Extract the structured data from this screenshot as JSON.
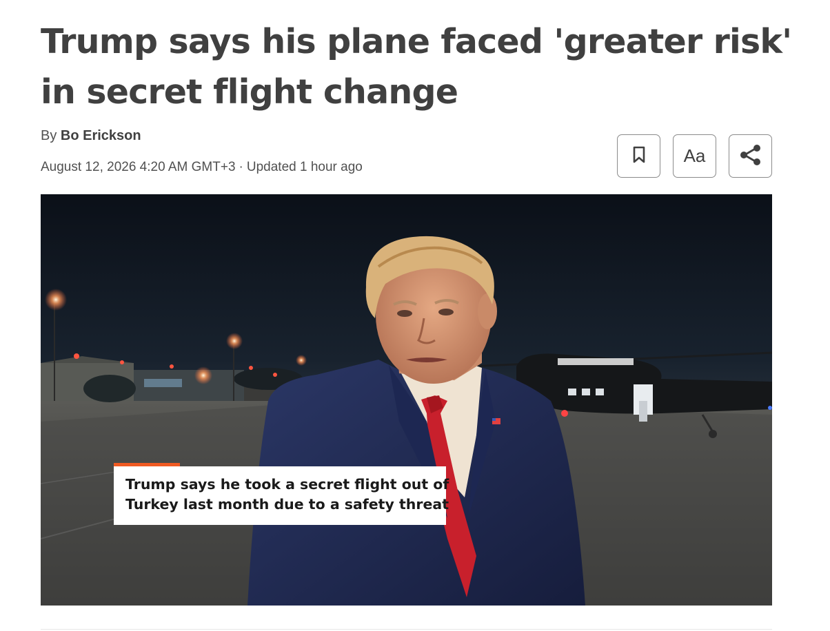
{
  "article": {
    "headline_line1": "Trump says his plane faced 'greater risk'",
    "headline_line2": "in secret flight change",
    "byline_prefix": "By",
    "author": "Bo Erickson",
    "published": "August 12, 2026 4:20 AM GMT+3",
    "separator": "·",
    "updated": "Updated 1 hour ago"
  },
  "toolbar": {
    "bookmark_icon": "bookmark-icon",
    "text_size_label": "Aa",
    "share_icon": "share-icon"
  },
  "media": {
    "caption_line1": "Trump says he took a secret flight out of",
    "caption_line2": "Turkey last month due to a safety threat",
    "accent_color": "#f05a22"
  }
}
